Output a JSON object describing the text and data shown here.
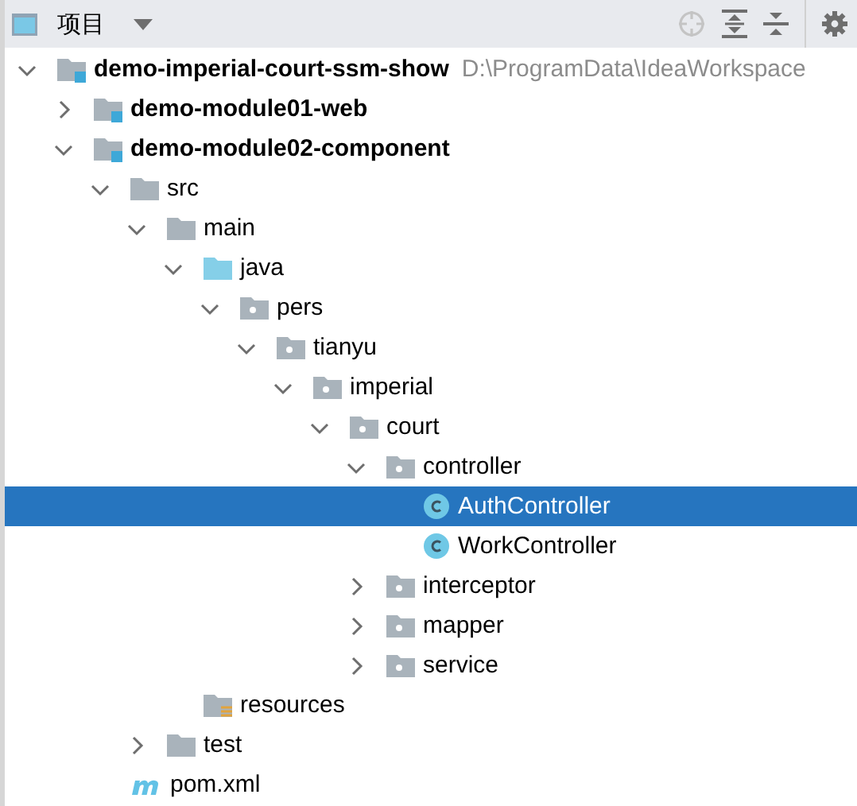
{
  "toolbar": {
    "title": "项目"
  },
  "tree": [
    {
      "label": "demo-imperial-court-ssm-show",
      "kind": "module",
      "hint": "D:\\ProgramData\\IdeaWorkspace",
      "expanded": true,
      "selected": false,
      "children": [
        {
          "label": "demo-module01-web",
          "kind": "module",
          "expanded": false,
          "selected": false
        },
        {
          "label": "demo-module02-component",
          "kind": "module",
          "expanded": true,
          "selected": false,
          "children": [
            {
              "label": "src",
              "kind": "folder",
              "expanded": true,
              "selected": false,
              "children": [
                {
                  "label": "main",
                  "kind": "folder",
                  "expanded": true,
                  "selected": false,
                  "children": [
                    {
                      "label": "java",
                      "kind": "source",
                      "expanded": true,
                      "selected": false,
                      "children": [
                        {
                          "label": "pers",
                          "kind": "package",
                          "expanded": true,
                          "selected": false,
                          "children": [
                            {
                              "label": "tianyu",
                              "kind": "package",
                              "expanded": true,
                              "selected": false,
                              "children": [
                                {
                                  "label": "imperial",
                                  "kind": "package",
                                  "expanded": true,
                                  "selected": false,
                                  "children": [
                                    {
                                      "label": "court",
                                      "kind": "package",
                                      "expanded": true,
                                      "selected": false,
                                      "children": [
                                        {
                                          "label": "controller",
                                          "kind": "package",
                                          "expanded": true,
                                          "selected": false,
                                          "children": [
                                            {
                                              "label": "AuthController",
                                              "kind": "class",
                                              "selected": true
                                            },
                                            {
                                              "label": "WorkController",
                                              "kind": "class",
                                              "selected": false
                                            }
                                          ]
                                        },
                                        {
                                          "label": "interceptor",
                                          "kind": "package",
                                          "expanded": false,
                                          "selected": false
                                        },
                                        {
                                          "label": "mapper",
                                          "kind": "package",
                                          "expanded": false,
                                          "selected": false
                                        },
                                        {
                                          "label": "service",
                                          "kind": "package",
                                          "expanded": false,
                                          "selected": false
                                        }
                                      ]
                                    }
                                  ]
                                }
                              ]
                            }
                          ]
                        }
                      ]
                    },
                    {
                      "label": "resources",
                      "kind": "resources",
                      "selected": false
                    }
                  ]
                },
                {
                  "label": "test",
                  "kind": "folder",
                  "expanded": false,
                  "selected": false
                }
              ]
            },
            {
              "label": "pom.xml",
              "kind": "maven",
              "selected": false
            }
          ]
        }
      ]
    }
  ]
}
